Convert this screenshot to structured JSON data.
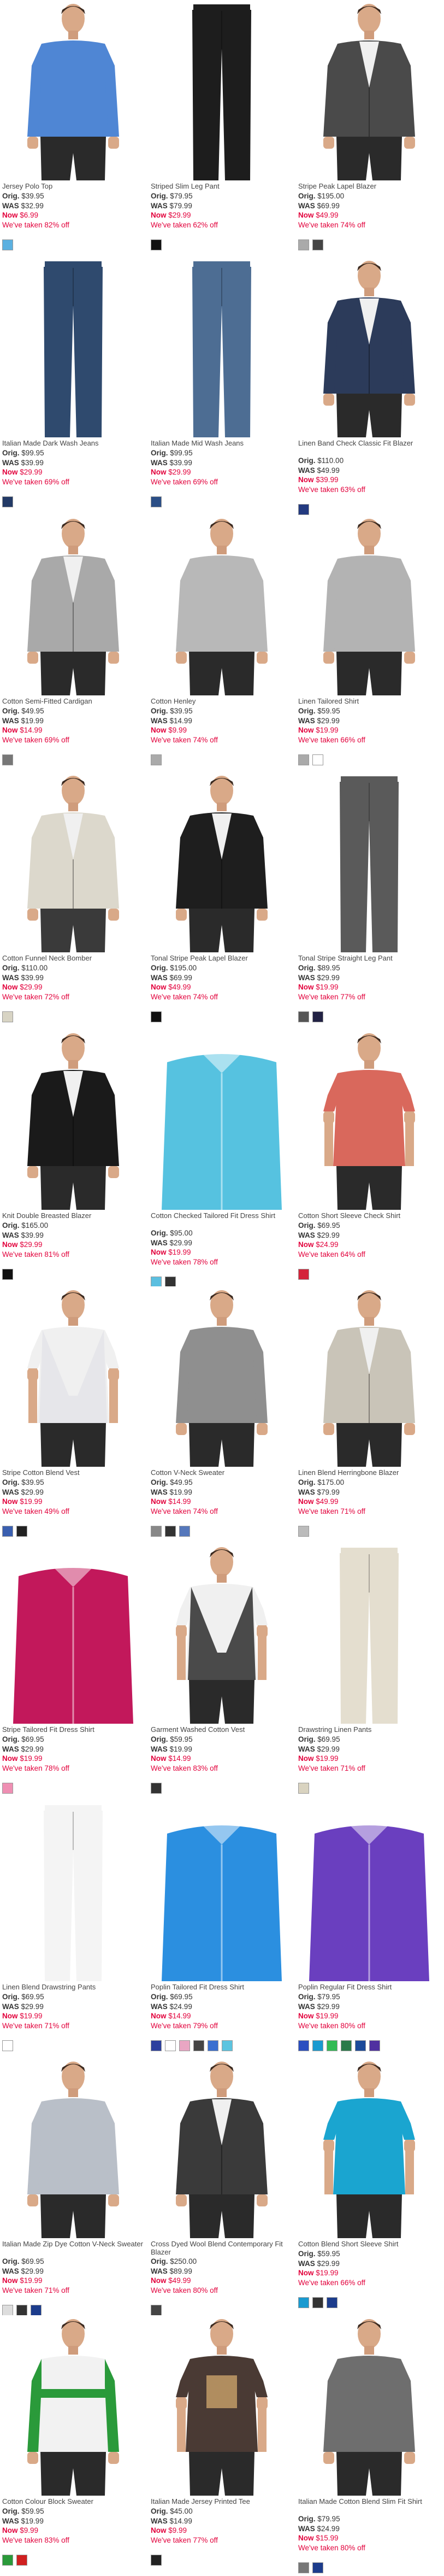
{
  "labels": {
    "orig": "Orig.",
    "was": "WAS",
    "now": "Now"
  },
  "products": [
    {
      "name": "Jersey Polo Top",
      "orig": "$39.95",
      "was": "$32.99",
      "now": "$6.99",
      "save": "We've taken 82% off",
      "kind": "polo",
      "color": "#4f86d4",
      "pants": "#2a2a2a",
      "swatches": [
        "#5bb0e0"
      ]
    },
    {
      "name": "Striped Slim Leg Pant",
      "orig": "$79.95",
      "was": "$79.99",
      "now": "$29.99",
      "save": "We've taken 62% off",
      "kind": "pants",
      "color": "#1d1d1d",
      "pants": "#1d1d1d",
      "swatches": [
        "#111111"
      ]
    },
    {
      "name": "Stripe Peak Lapel Blazer",
      "orig": "$195.00",
      "was": "$69.99",
      "now": "$49.99",
      "save": "We've taken 74% off",
      "kind": "blazer",
      "color": "#4a4a4a",
      "pants": "#2a2a2a",
      "swatches": [
        "#aaaaaa",
        "#444444"
      ]
    },
    {
      "name": "Italian Made Dark Wash Jeans",
      "orig": "$99.95",
      "was": "$39.99",
      "now": "$29.99",
      "save": "We've taken 69% off",
      "kind": "pants",
      "color": "#2f4a6e",
      "pants": "#2f4a6e",
      "swatches": [
        "#233a66"
      ]
    },
    {
      "name": "Italian Made Mid Wash Jeans",
      "orig": "$99.95",
      "was": "$39.99",
      "now": "$29.99",
      "save": "We've taken 69% off",
      "kind": "pants",
      "color": "#4d6d93",
      "pants": "#4d6d93",
      "swatches": [
        "#2b4e86"
      ]
    },
    {
      "name": "Linen Band Check Classic Fit Blazer",
      "orig": "$110.00",
      "was": "$49.99",
      "now": "$39.99",
      "save": "We've taken 63% off",
      "kind": "blazer",
      "color": "#2c3b5a",
      "pants": "#2a2a2a",
      "swatches": [
        "#233a80"
      ]
    },
    {
      "name": "Cotton Semi-Fitted Cardigan",
      "orig": "$49.95",
      "was": "$19.99",
      "now": "$14.99",
      "save": "We've taken 69% off",
      "kind": "cardigan",
      "color": "#a9a9a9",
      "pants": "#2a2a2a",
      "swatches": [
        "#777777"
      ]
    },
    {
      "name": "Cotton Henley",
      "orig": "$39.95",
      "was": "$14.99",
      "now": "$9.99",
      "save": "We've taken 74% off",
      "kind": "sweater",
      "color": "#b8b8b8",
      "pants": "#2a2a2a",
      "swatches": [
        "#aaaaaa"
      ]
    },
    {
      "name": "Linen Tailored Shirt",
      "orig": "$59.95",
      "was": "$29.99",
      "now": "$19.99",
      "save": "We've taken 66% off",
      "kind": "shirt",
      "color": "#b3b3b3",
      "pants": "#2a2a2a",
      "swatches": [
        "#aaaaaa",
        "#ffffff"
      ]
    },
    {
      "name": "Cotton Funnel Neck Bomber",
      "orig": "$110.00",
      "was": "$39.99",
      "now": "$29.99",
      "save": "We've taken 72% off",
      "kind": "jacket",
      "color": "#dcd8cc",
      "pants": "#3a3a3a",
      "swatches": [
        "#d8d4c4"
      ]
    },
    {
      "name": "Tonal Stripe Peak Lapel Blazer",
      "orig": "$195.00",
      "was": "$69.99",
      "now": "$49.99",
      "save": "We've taken 74% off",
      "kind": "blazer",
      "color": "#1e1e1e",
      "pants": "#2a2a2a",
      "swatches": [
        "#111111"
      ]
    },
    {
      "name": "Tonal Stripe Straight Leg Pant",
      "orig": "$89.95",
      "was": "$29.99",
      "now": "$19.99",
      "save": "We've taken 77% off",
      "kind": "pants",
      "color": "#5a5a5a",
      "pants": "#5a5a5a",
      "swatches": [
        "#555555",
        "#222244"
      ]
    },
    {
      "name": "Knit Double Breasted Blazer",
      "orig": "$165.00",
      "was": "$39.99",
      "now": "$29.99",
      "save": "We've taken 81% off",
      "kind": "blazer",
      "color": "#1a1a1a",
      "pants": "#2a2a2a",
      "swatches": [
        "#111111"
      ]
    },
    {
      "name": "Cotton Checked Tailored Fit Dress Shirt",
      "orig": "$95.00",
      "was": "$29.99",
      "now": "$19.99",
      "save": "We've taken 78% off",
      "kind": "flatshirt",
      "color": "#56c2e0",
      "pants": "#2a2a2a",
      "swatches": [
        "#5bbfe0",
        "#333333"
      ]
    },
    {
      "name": "Cotton Short Sleeve Check Shirt",
      "orig": "$69.95",
      "was": "$29.99",
      "now": "$24.99",
      "save": "We've taken 64% off",
      "kind": "shortshirt",
      "color": "#d9685c",
      "pants": "#2a2a2a",
      "swatches": [
        "#d4243a"
      ]
    },
    {
      "name": "Stripe Cotton Blend Vest",
      "orig": "$39.95",
      "was": "$29.99",
      "now": "$19.99",
      "save": "We've taken 49% off",
      "kind": "vest",
      "color": "#e6e6ea",
      "pants": "#2a2a2a",
      "swatches": [
        "#3a5fb0",
        "#222222"
      ]
    },
    {
      "name": "Cotton V-Neck Sweater",
      "orig": "$49.95",
      "was": "$19.99",
      "now": "$14.99",
      "save": "We've taken 74% off",
      "kind": "sweater",
      "color": "#8f8f8f",
      "pants": "#2a2a2a",
      "swatches": [
        "#888888",
        "#333333",
        "#5577bb"
      ]
    },
    {
      "name": "Linen Blend Herringbone Blazer",
      "orig": "$175.00",
      "was": "$79.99",
      "now": "$49.99",
      "save": "We've taken 71% off",
      "kind": "blazer",
      "color": "#c9c4b8",
      "pants": "#2a2a2a",
      "swatches": [
        "#bbbbbb"
      ]
    },
    {
      "name": "Stripe Tailored Fit Dress Shirt",
      "orig": "$69.95",
      "was": "$29.99",
      "now": "$19.99",
      "save": "We've taken 78% off",
      "kind": "flatshirt",
      "color": "#c2185b",
      "pants": "#2a2a2a",
      "swatches": [
        "#ef8fb3"
      ]
    },
    {
      "name": "Garment Washed Cotton Vest",
      "orig": "$59.95",
      "was": "$19.99",
      "now": "$14.99",
      "save": "We've taken 83% off",
      "kind": "vest",
      "color": "#4a4a4a",
      "pants": "#2a2a2a",
      "swatches": [
        "#333333"
      ]
    },
    {
      "name": "Drawstring Linen Pants",
      "orig": "$69.95",
      "was": "$29.99",
      "now": "$19.99",
      "save": "We've taken 71% off",
      "kind": "pants",
      "color": "#e4decf",
      "pants": "#e4decf",
      "swatches": [
        "#d9d3c0"
      ]
    },
    {
      "name": "Linen Blend Drawstring Pants",
      "orig": "$69.95",
      "was": "$29.99",
      "now": "$19.99",
      "save": "We've taken 71% off",
      "kind": "pants",
      "color": "#f4f4f4",
      "pants": "#f4f4f4",
      "swatches": [
        "#ffffff"
      ]
    },
    {
      "name": "Poplin Tailored Fit Dress Shirt",
      "orig": "$69.95",
      "was": "$24.99",
      "now": "$14.99",
      "save": "We've taken 79% off",
      "kind": "flatshirt",
      "color": "#2b8fe0",
      "pants": "#2a2a2a",
      "swatches": [
        "#2b3f9e",
        "#ffffff",
        "#e9a6c3",
        "#444444",
        "#3a6fd0",
        "#5bc4e0"
      ]
    },
    {
      "name": "Poplin Regular Fit Dress Shirt",
      "orig": "$79.95",
      "was": "$29.99",
      "now": "$19.99",
      "save": "We've taken 80% off",
      "kind": "flatshirt",
      "color": "#6a3fbf",
      "pants": "#2a2a2a",
      "swatches": [
        "#2a4ec0",
        "#1a9ad0",
        "#33bb55",
        "#2a7a4a",
        "#1c4a9a",
        "#5030a0"
      ]
    },
    {
      "name": "Italian Made Zip Dye Cotton V-Neck Sweater",
      "orig": "$69.95",
      "was": "$29.99",
      "now": "$19.99",
      "save": "We've taken 71% off",
      "kind": "sweater",
      "color": "#b9bfc8",
      "pants": "#2a2a2a",
      "swatches": [
        "#dddddd",
        "#333333",
        "#1c3c8c"
      ]
    },
    {
      "name": "Cross Dyed Wool Blend Contemporary Fit Blazer",
      "orig": "$250.00",
      "was": "$89.99",
      "now": "$49.99",
      "save": "We've taken 80% off",
      "kind": "blazer",
      "color": "#3a3a3a",
      "pants": "#2a2a2a",
      "swatches": [
        "#444444"
      ]
    },
    {
      "name": "Cotton Blend Short Sleeve Shirt",
      "orig": "$59.95",
      "was": "$29.99",
      "now": "$19.99",
      "save": "We've taken 66% off",
      "kind": "shortshirt",
      "color": "#1aa5d0",
      "pants": "#2a2a2a",
      "swatches": [
        "#1a9ad0",
        "#333333",
        "#1c3c8c"
      ]
    },
    {
      "name": "Cotton Colour Block Sweater",
      "orig": "$59.95",
      "was": "$19.99",
      "now": "$9.99",
      "save": "We've taken 83% off",
      "kind": "colorblock",
      "color": "#f2f2f2",
      "pants": "#2a2a2a",
      "swatches": [
        "#2a9a3a",
        "#d02020"
      ]
    },
    {
      "name": "Italian Made Jersey Printed Tee",
      "orig": "$45.00",
      "was": "$14.99",
      "now": "$9.99",
      "save": "We've taken 77% off",
      "kind": "tee",
      "color": "#4a3a34",
      "pants": "#2a2a2a",
      "swatches": [
        "#222222"
      ]
    },
    {
      "name": "Italian Made Cotton Blend Slim Fit Shirt",
      "orig": "$79.95",
      "was": "$24.99",
      "now": "$15.99",
      "save": "We've taken 80% off",
      "kind": "shirt",
      "color": "#6e6e6e",
      "pants": "#2a2a2a",
      "swatches": [
        "#777777",
        "#1c3c8c"
      ]
    }
  ]
}
